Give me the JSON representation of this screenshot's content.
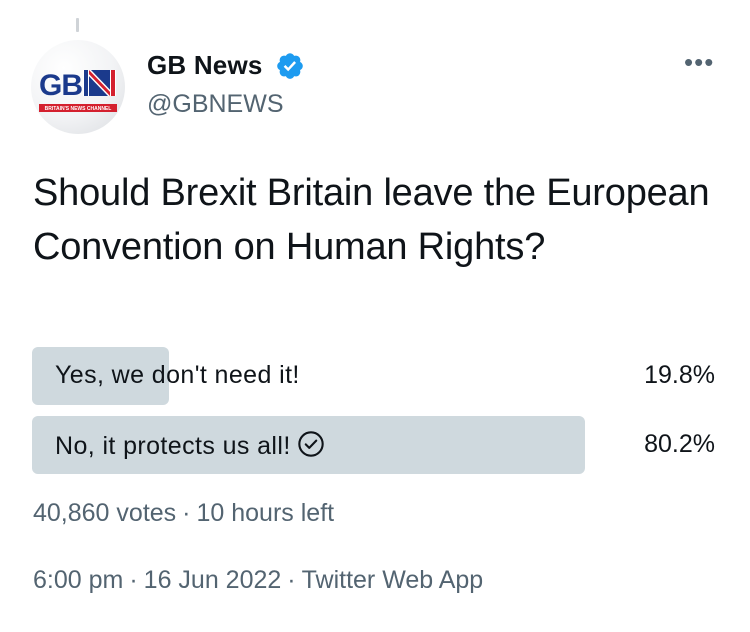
{
  "tweet": {
    "display_name": "GB News",
    "handle": "@GBNEWS",
    "question": "Should Brexit Britain leave the European Convention on Human Rights?",
    "time": "6:00 pm",
    "date": "16 Jun 2022",
    "source": "Twitter Web App",
    "separator": "·"
  },
  "avatar": {
    "logo_text": "GBN",
    "tagline": "BRITAIN'S NEWS CHANNEL"
  },
  "poll": {
    "options": [
      {
        "label": "Yes, we don't need it!",
        "percent_text": "19.8%",
        "percent": 19.8,
        "selected": false
      },
      {
        "label": "No, it protects us all!",
        "percent_text": "80.2%",
        "percent": 80.2,
        "selected": true
      }
    ],
    "votes": "40,860 votes",
    "time_left": "10 hours left"
  },
  "icons": {
    "verified": "verified-badge-icon",
    "more": "more-options-icon",
    "selected": "check-circle-icon"
  },
  "colors": {
    "verified_blue": "#1d9bf0",
    "poll_bar": "#cfd9de",
    "secondary_text": "#536471",
    "logo_blue": "#1b3a8c",
    "logo_red": "#d4202e"
  }
}
